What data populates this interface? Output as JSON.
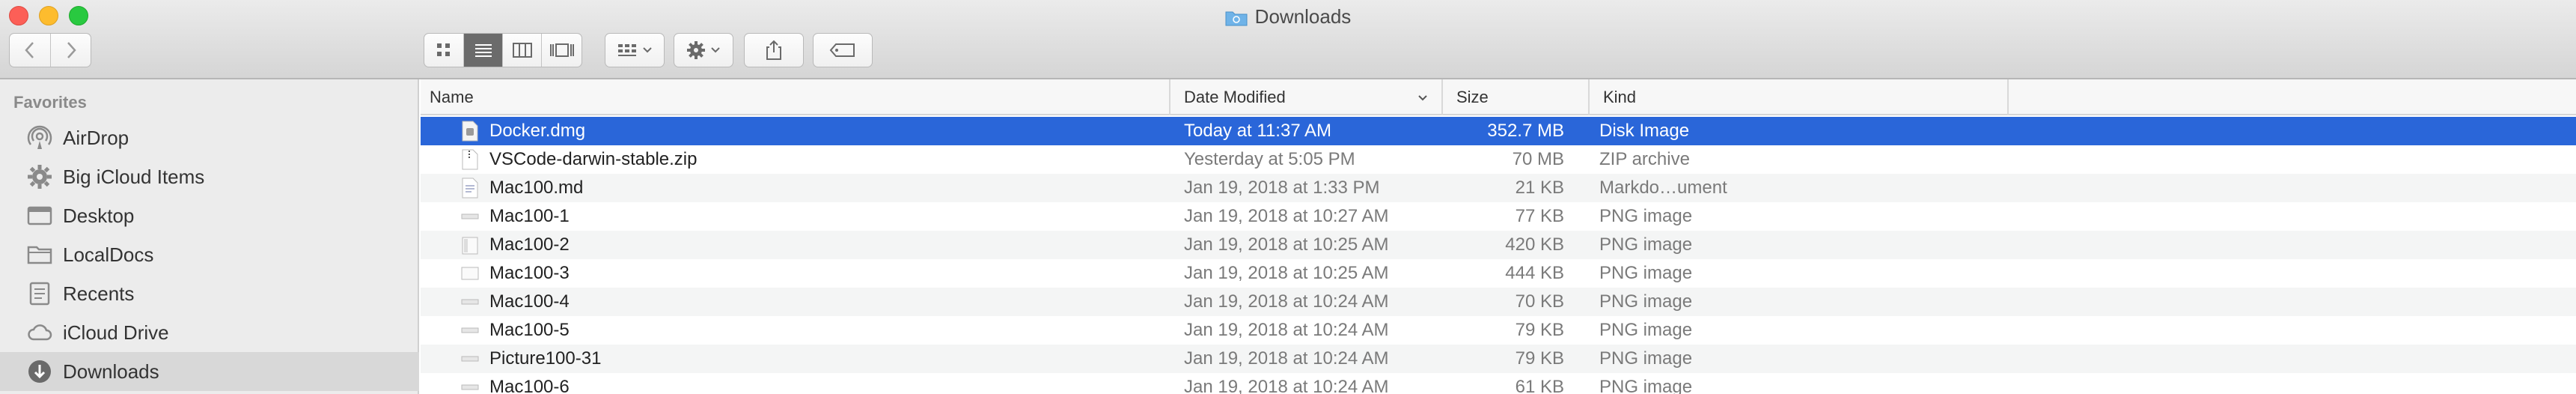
{
  "window": {
    "title": "Downloads"
  },
  "toolbar": {
    "view_buttons": [
      "icon-view-icon",
      "list-view-icon",
      "column-view-icon",
      "gallery-view-icon"
    ],
    "active_view": "list"
  },
  "sidebar": {
    "heading": "Favorites",
    "items": [
      {
        "label": "AirDrop",
        "icon": "airdrop-icon"
      },
      {
        "label": "Big iCloud Items",
        "icon": "gear-folder-icon"
      },
      {
        "label": "Desktop",
        "icon": "desktop-icon"
      },
      {
        "label": "LocalDocs",
        "icon": "folder-icon"
      },
      {
        "label": "Recents",
        "icon": "clock-icon"
      },
      {
        "label": "iCloud Drive",
        "icon": "cloud-icon"
      },
      {
        "label": "Downloads",
        "icon": "download-icon",
        "selected": true
      }
    ]
  },
  "columns": {
    "name": "Name",
    "date": "Date Modified",
    "size": "Size",
    "kind": "Kind"
  },
  "files": [
    {
      "name": "Docker.dmg",
      "date": "Today at 11:37 AM",
      "size": "352.7 MB",
      "kind": "Disk Image",
      "selected": true
    },
    {
      "name": "VSCode-darwin-stable.zip",
      "date": "Yesterday at 5:05 PM",
      "size": "70 MB",
      "kind": "ZIP archive"
    },
    {
      "name": "Mac100.md",
      "date": "Jan 19, 2018 at 1:33 PM",
      "size": "21 KB",
      "kind": "Markdo…ument"
    },
    {
      "name": "Mac100-1",
      "date": "Jan 19, 2018 at 10:27 AM",
      "size": "77 KB",
      "kind": "PNG image"
    },
    {
      "name": "Mac100-2",
      "date": "Jan 19, 2018 at 10:25 AM",
      "size": "420 KB",
      "kind": "PNG image"
    },
    {
      "name": "Mac100-3",
      "date": "Jan 19, 2018 at 10:25 AM",
      "size": "444 KB",
      "kind": "PNG image"
    },
    {
      "name": "Mac100-4",
      "date": "Jan 19, 2018 at 10:24 AM",
      "size": "70 KB",
      "kind": "PNG image"
    },
    {
      "name": "Mac100-5",
      "date": "Jan 19, 2018 at 10:24 AM",
      "size": "79 KB",
      "kind": "PNG image"
    },
    {
      "name": "Picture100-31",
      "date": "Jan 19, 2018 at 10:24 AM",
      "size": "79 KB",
      "kind": "PNG image"
    },
    {
      "name": "Mac100-6",
      "date": "Jan 19, 2018 at 10:24 AM",
      "size": "61 KB",
      "kind": "PNG image"
    }
  ],
  "colors": {
    "selection": "#2a66d9",
    "sidebar_bg": "#ececec"
  }
}
